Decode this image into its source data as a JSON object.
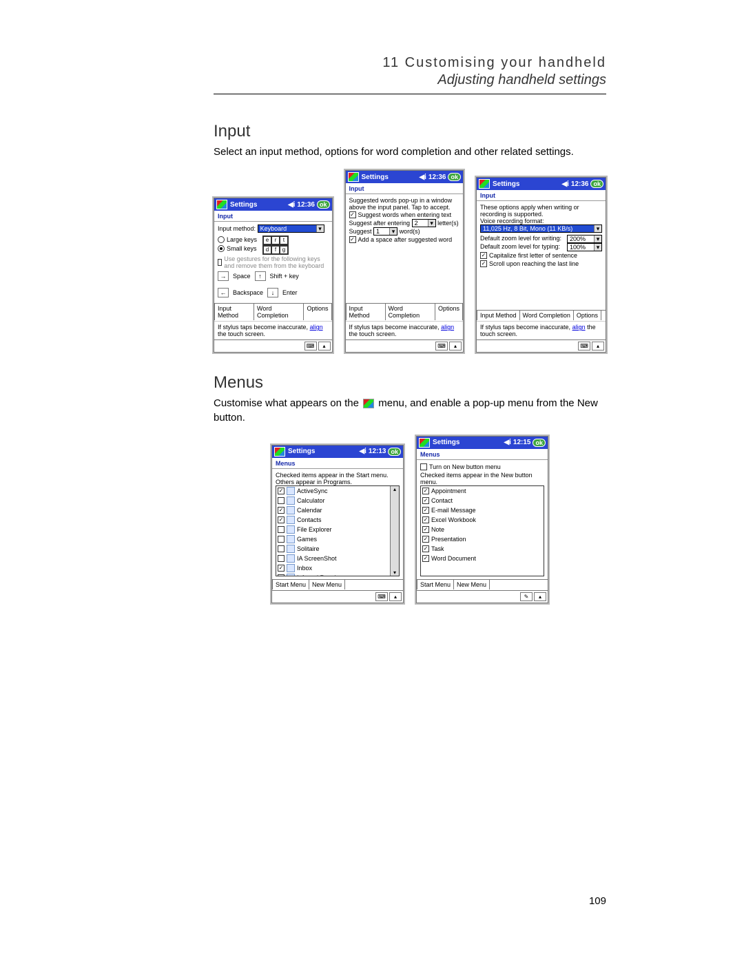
{
  "header": {
    "chapter": "11 Customising your handheld",
    "subtitle": "Adjusting handheld settings"
  },
  "page_number": "109",
  "section_input": {
    "heading": "Input",
    "body": "Select an input method, options for word completion and other related settings."
  },
  "section_menus": {
    "heading": "Menus",
    "body_pre": "Customise what appears on the ",
    "body_post": " menu, and enable a pop-up menu from the New button."
  },
  "shot_input_method": {
    "title": "Settings",
    "time": "12:36",
    "ok": "ok",
    "app": "Input",
    "lbl_method": "Input method:",
    "method_val": "Keyboard",
    "large": "Large keys",
    "small": "Small keys",
    "keys_top": [
      "e",
      "r",
      "t"
    ],
    "keys_bot": [
      "d",
      "f",
      "g"
    ],
    "gest_intro": "Use gestures for the following keys and remove them from the keyboard",
    "g_space": "Space",
    "g_shift": "Shift + key",
    "g_back": "Backspace",
    "g_enter": "Enter",
    "tabs": [
      "Input Method",
      "Word Completion",
      "Options"
    ],
    "stylus_pre": "If stylus taps become inaccurate, ",
    "stylus_link": "align",
    "stylus_post": " the touch screen."
  },
  "shot_word": {
    "title": "Settings",
    "time": "12:36",
    "ok": "ok",
    "app": "Input",
    "intro": "Suggested words pop-up in a window above the input panel.  Tap to accept.",
    "opt_suggest": "Suggest words when entering text",
    "opt_after_pre": "Suggest after entering",
    "opt_after_n": "2",
    "opt_after_post": "letter(s)",
    "opt_sugg_pre": "Suggest",
    "opt_sugg_n": "1",
    "opt_sugg_post": "word(s)",
    "opt_space": "Add a space after suggested word",
    "tabs": [
      "Input Method",
      "Word Completion",
      "Options"
    ],
    "stylus_pre": "If stylus taps become inaccurate, ",
    "stylus_link": "align",
    "stylus_post": " the touch screen."
  },
  "shot_options": {
    "title": "Settings",
    "time": "12:36",
    "ok": "ok",
    "app": "Input",
    "intro": "These options apply when writing or recording is supported.",
    "lbl_rec": "Voice recording format:",
    "rec_val": "11,025 Hz, 8 Bit, Mono (11 KB/s)",
    "lbl_zw": "Default zoom level for writing:",
    "zw": "200%",
    "lbl_zt": "Default zoom level for typing:",
    "zt": "100%",
    "opt_cap": "Capitalize first letter of sentence",
    "opt_scroll": "Scroll upon reaching the last line",
    "tabs": [
      "Input Method",
      "Word Completion",
      "Options"
    ],
    "stylus_pre": "If stylus taps become inaccurate, ",
    "stylus_link": "align",
    "stylus_post": " the touch screen."
  },
  "shot_menus_start": {
    "title": "Settings",
    "time": "12:13",
    "ok": "ok",
    "app": "Menus",
    "intro": "Checked items appear in the Start menu. Others appear in Programs.",
    "items": [
      {
        "label": "ActiveSync",
        "checked": true
      },
      {
        "label": "Calculator",
        "checked": false
      },
      {
        "label": "Calendar",
        "checked": true
      },
      {
        "label": "Contacts",
        "checked": true
      },
      {
        "label": "File Explorer",
        "checked": false
      },
      {
        "label": "Games",
        "checked": false
      },
      {
        "label": "Solitaire",
        "checked": false
      },
      {
        "label": "IA ScreenShot",
        "checked": false
      },
      {
        "label": "Inbox",
        "checked": true
      },
      {
        "label": "Infrared Receive",
        "checked": false
      }
    ],
    "tabs": [
      "Start Menu",
      "New Menu"
    ]
  },
  "shot_menus_new": {
    "title": "Settings",
    "time": "12:15",
    "ok": "ok",
    "app": "Menus",
    "opt_turn": "Turn on New button menu",
    "intro": "Checked items appear in the New button menu.",
    "items": [
      {
        "label": "Appointment",
        "checked": true
      },
      {
        "label": "Contact",
        "checked": true
      },
      {
        "label": "E-mail Message",
        "checked": true
      },
      {
        "label": "Excel Workbook",
        "checked": true
      },
      {
        "label": "Note",
        "checked": true
      },
      {
        "label": "Presentation",
        "checked": true
      },
      {
        "label": "Task",
        "checked": true
      },
      {
        "label": "Word Document",
        "checked": true
      }
    ],
    "tabs": [
      "Start Menu",
      "New Menu"
    ]
  }
}
